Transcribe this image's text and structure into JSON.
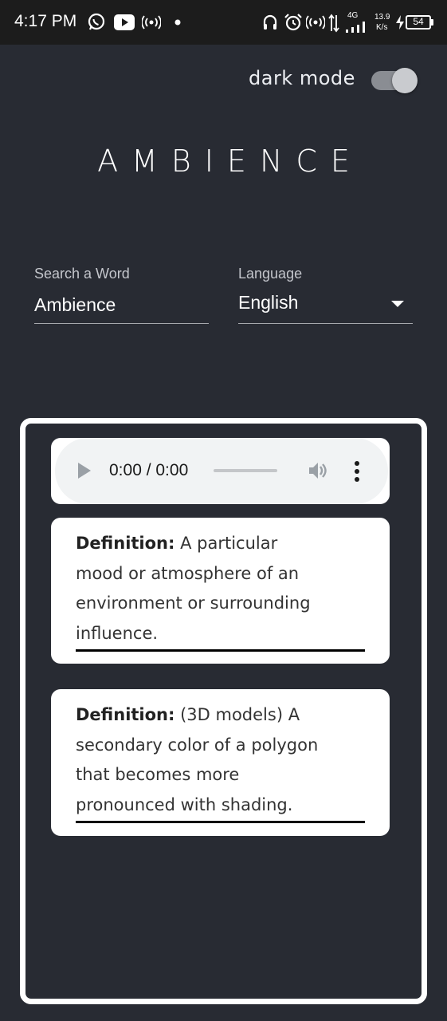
{
  "status_bar": {
    "time": "4:17 PM",
    "network_type": "4G",
    "speed_value": "13.9",
    "speed_unit": "K/s",
    "battery": "54",
    "icons": [
      "whatsapp-icon",
      "youtube-icon",
      "hotspot-icon",
      "dot-icon",
      "headphones-icon",
      "alarm-icon",
      "hotspot-icon",
      "data-arrows-icon",
      "signal-icon",
      "charging-icon",
      "battery-icon"
    ]
  },
  "header": {
    "dark_mode_label": "dark mode",
    "dark_mode_on": true,
    "title": "AMBIENCE"
  },
  "search": {
    "label": "Search a Word",
    "value": "Ambience"
  },
  "language": {
    "label": "Language",
    "selected": "English"
  },
  "audio": {
    "time": "0:00 / 0:00",
    "progress": 0
  },
  "definitions": [
    {
      "prefix": "Definition:",
      "lines": [
        "A particular",
        "mood or atmosphere of an",
        "environment or surrounding",
        "influence."
      ]
    },
    {
      "prefix": "Definition:",
      "lines": [
        "(3D models) A",
        "secondary color of a polygon",
        "that becomes more",
        "pronounced with shading."
      ]
    }
  ],
  "colors": {
    "background": "#282b33",
    "status_bar": "#1c1c1c",
    "card": "#ffffff",
    "audio_bg": "#f1f3f4"
  }
}
